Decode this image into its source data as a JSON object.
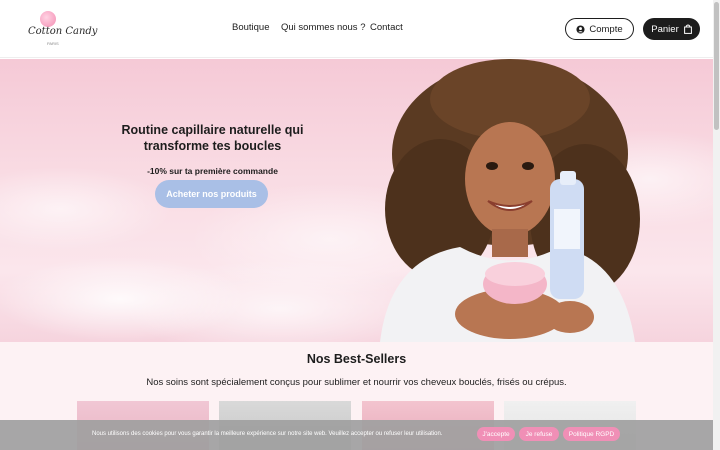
{
  "header": {
    "logo_text": "Cotton Candy",
    "logo_sub": "PARIS",
    "nav": [
      {
        "label": "Boutique"
      },
      {
        "label": "Qui sommes nous ?"
      },
      {
        "label": "Contact"
      }
    ],
    "account_label": "Compte",
    "cart_label": "Panier"
  },
  "hero": {
    "title_line1": "Routine capillaire naturelle qui",
    "title_line2": "transforme tes boucles",
    "offer": "-10% sur ta première commande",
    "cta": "Acheter nos produits"
  },
  "bestsellers": {
    "title": "Nos Best-Sellers",
    "description": "Nos soins sont spécialement conçus pour sublimer et nourrir vos cheveux bouclés, frisés ou crépus."
  },
  "cookie": {
    "text": "Nous utilisons des cookies pour vous garantir la meilleure expérience sur notre site web. Veuillez accepter ou refuser leur utilisation.",
    "accept": "J'accepte",
    "refuse": "Je refuse",
    "policy": "Politique RGPD"
  },
  "colors": {
    "accent_pink": "#f08fb6",
    "cta_blue": "#a9bfe6",
    "dark": "#1d1d1d"
  },
  "icons": {
    "account": "user-icon",
    "cart": "shopping-bag-icon"
  }
}
